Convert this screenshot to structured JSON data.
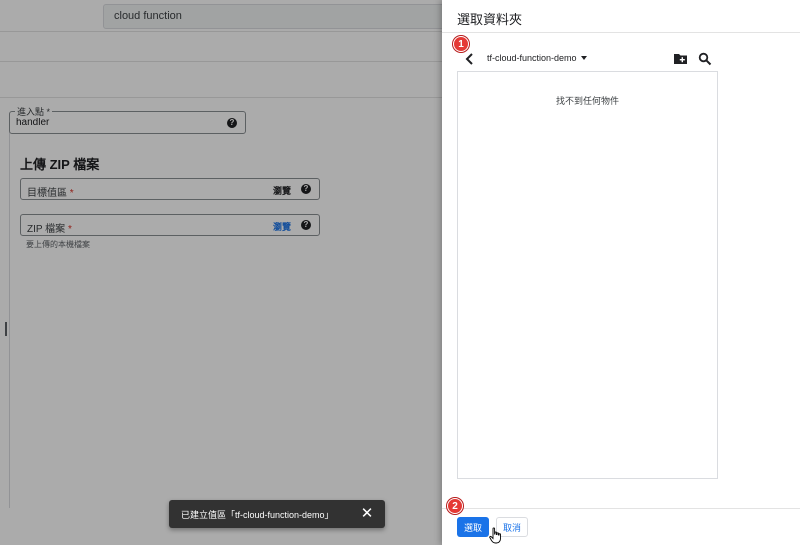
{
  "background": {
    "search_value": "cloud function",
    "entry_point": {
      "label": "進入點",
      "required_mark": "*",
      "value": "handler"
    },
    "upload_section_title": "上傳 ZIP 檔案",
    "bucket_field": {
      "label": "目標值區",
      "required_mark": "*",
      "browse_label": "瀏覽"
    },
    "zip_field": {
      "label": "ZIP 檔案",
      "required_mark": "*",
      "browse_label": "瀏覽",
      "hint": "要上傳的本機檔案"
    }
  },
  "snackbar": {
    "message": "已建立值區「tf-cloud-function-demo」",
    "close_icon": "close-icon"
  },
  "panel": {
    "title": "選取資料夾",
    "current_folder": "tf-cloud-function-demo",
    "empty_message": "找不到任何物件",
    "select_label": "選取",
    "cancel_label": "取消",
    "icons": [
      "back-arrow-icon",
      "dropdown-caret-icon",
      "new-folder-icon",
      "search-icon"
    ]
  },
  "annotations": {
    "badge_1": "1",
    "badge_2": "2"
  },
  "colors": {
    "accent": "#1a73e8",
    "badge": "#e53935",
    "required": "#d93025",
    "snackbar": "#323232"
  }
}
